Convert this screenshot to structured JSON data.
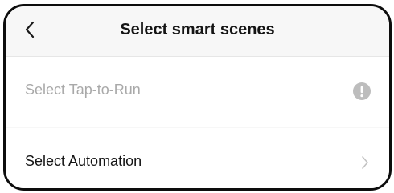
{
  "header": {
    "title": "Select smart scenes",
    "back_icon": "chevron-left-icon"
  },
  "rows": [
    {
      "label": "Select Tap-to-Run",
      "state": "disabled",
      "trailing_icon": "exclamation-circle-icon"
    },
    {
      "label": "Select Automation",
      "state": "enabled",
      "trailing_icon": "chevron-right-icon"
    }
  ],
  "colors": {
    "background": "#f7f7f7",
    "row_background": "#ffffff",
    "text_primary": "#141414",
    "text_disabled": "#a9a9a9",
    "icon_gray": "#bdbdbd",
    "border": "#0d0d0d"
  }
}
